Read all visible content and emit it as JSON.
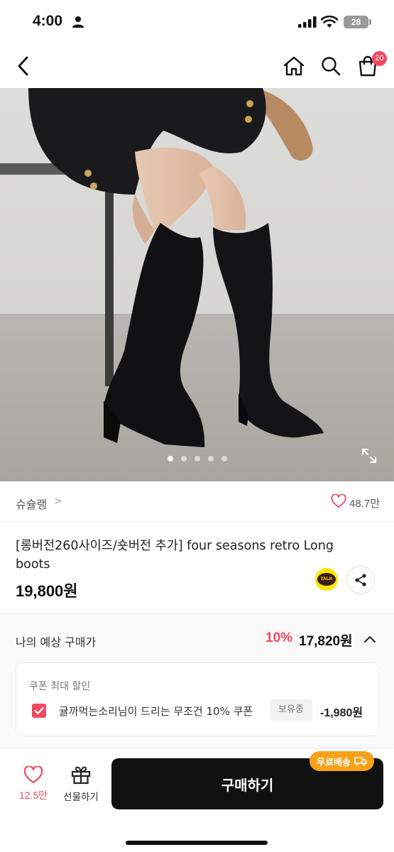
{
  "status_bar": {
    "time": "4:00",
    "battery": "28"
  },
  "nav": {
    "cart_count": "20"
  },
  "hero": {
    "dots_total": 5,
    "active_dot": 1
  },
  "brand": {
    "name": "슈슐랭",
    "chevron": ">",
    "like_count": "48.7만"
  },
  "product": {
    "title": "[롱버전260사이즈/숏버전 추가] four seasons retro Long boots",
    "price": "19,800원"
  },
  "share": {
    "kakao_label": "TALK"
  },
  "expected": {
    "label": "나의 예상 구매가",
    "discount_pct": "10%",
    "price": "17,820원"
  },
  "coupon": {
    "heading": "쿠폰 최대 할인",
    "name": "귤까먹는소리님이 드리는 무조건 10% 쿠폰",
    "badge": "보유중",
    "amount": "-1,980원",
    "checked": true
  },
  "bottom_bar": {
    "like_count": "12.5만",
    "gift_label": "선물하기",
    "buy_label": "구매하기",
    "free_shipping": "무료배송"
  },
  "colors": {
    "accent": "#f0495f",
    "button": "#111111",
    "free_shipping": "#f7a11a",
    "kakao": "#fee500"
  }
}
